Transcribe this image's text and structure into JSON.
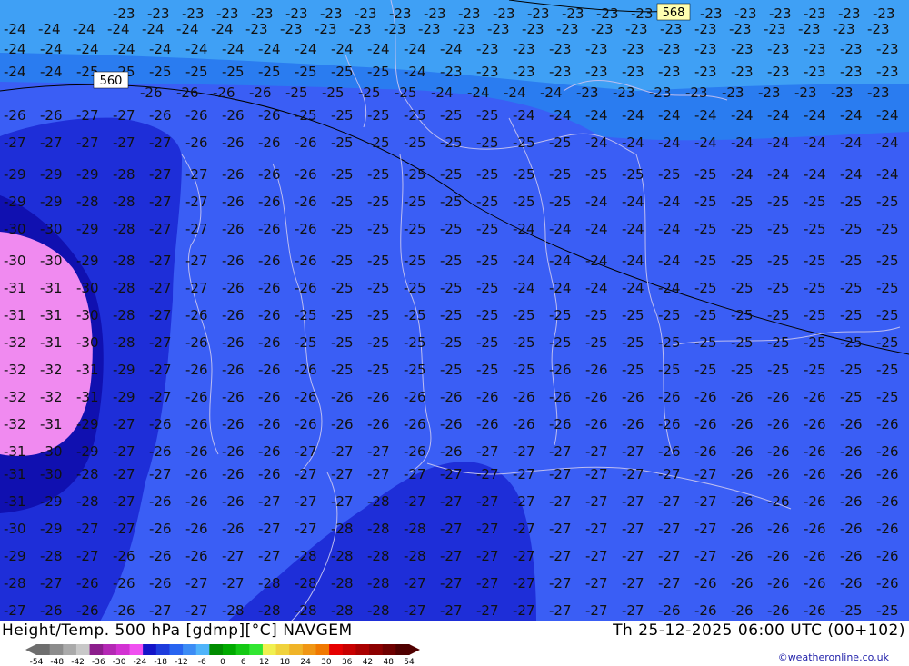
{
  "map": {
    "height_labels": [
      "560",
      "568"
    ],
    "contour_labels": {
      "m23": "-23",
      "m24": "-24",
      "m25": "-25",
      "m26": "-26",
      "m27": "-27",
      "m28": "-28",
      "m29": "-29",
      "m30": "-30",
      "m31": "-31",
      "m32": "-32"
    },
    "colors": {
      "t22_23": "#3fa0f5",
      "t24": "#2a7cf0",
      "t25_27": "#3a5ef5",
      "t28_30": "#1e2ed8",
      "t31_32": "#1010b0",
      "t_cold": "#f08af0",
      "borders": "#bdbdf0"
    }
  },
  "footer": {
    "title": "Height/Temp. 500 hPa [gdmp][°C] NAVGEM",
    "datetime": "Th 25-12-2025 06:00 UTC (00+102)",
    "credit": "©weatheronline.co.uk"
  },
  "legend": {
    "ticks": [
      "-54",
      "-48",
      "-42",
      "-36",
      "-30",
      "-24",
      "-18",
      "-12",
      "-6",
      "0",
      "6",
      "12",
      "18",
      "24",
      "30",
      "36",
      "42",
      "48",
      "54"
    ],
    "colors": [
      "#6e6e6e",
      "#8c8c8c",
      "#aaaaaa",
      "#c8c8c8",
      "#8c1e8c",
      "#b428b4",
      "#d232d2",
      "#f050f0",
      "#1414c8",
      "#1e3cdc",
      "#2864f0",
      "#3c8cf5",
      "#50b4fa",
      "#008c00",
      "#00aa00",
      "#14c814",
      "#32e632",
      "#f0f050",
      "#f0d23c",
      "#f0b428",
      "#f09614",
      "#f07800",
      "#e60000",
      "#c80000",
      "#aa0000",
      "#8c0000",
      "#6e0000",
      "#500000"
    ]
  }
}
